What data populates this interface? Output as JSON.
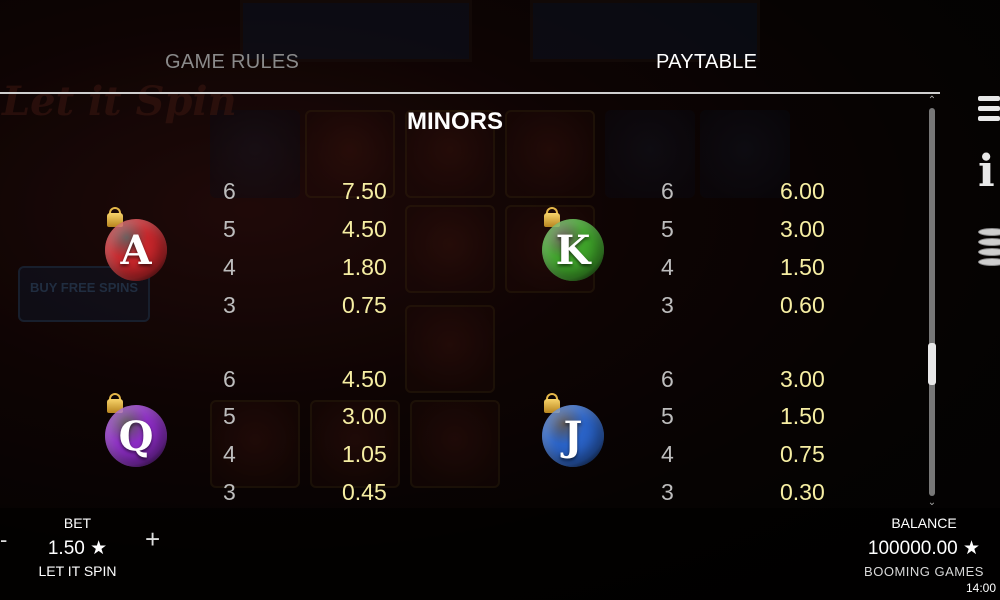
{
  "tabs": {
    "game_rules": "GAME RULES",
    "paytable": "PAYTABLE"
  },
  "section_title": "MINORS",
  "symbols": [
    {
      "letter": "A",
      "color": "#c8262b",
      "pays": [
        {
          "count": "6",
          "value": "7.50"
        },
        {
          "count": "5",
          "value": "4.50"
        },
        {
          "count": "4",
          "value": "1.80"
        },
        {
          "count": "3",
          "value": "0.75"
        }
      ]
    },
    {
      "letter": "K",
      "color": "#3fa42a",
      "pays": [
        {
          "count": "6",
          "value": "6.00"
        },
        {
          "count": "5",
          "value": "3.00"
        },
        {
          "count": "4",
          "value": "1.50"
        },
        {
          "count": "3",
          "value": "0.60"
        }
      ]
    },
    {
      "letter": "Q",
      "color": "#8c2cc4",
      "pays": [
        {
          "count": "6",
          "value": "4.50"
        },
        {
          "count": "5",
          "value": "3.00"
        },
        {
          "count": "4",
          "value": "1.05"
        },
        {
          "count": "3",
          "value": "0.45"
        }
      ]
    },
    {
      "letter": "J",
      "color": "#2a63c8",
      "pays": [
        {
          "count": "6",
          "value": "3.00"
        },
        {
          "count": "5",
          "value": "1.50"
        },
        {
          "count": "4",
          "value": "0.75"
        },
        {
          "count": "3",
          "value": "0.30"
        }
      ]
    }
  ],
  "background": {
    "logo": "Let it Spin",
    "buy_button": "BUY FREE SPINS"
  },
  "icons": {
    "menu": "menu-icon",
    "info": "info-icon",
    "coins": "coins-icon"
  },
  "bet": {
    "label": "BET",
    "value": "1.50 ★",
    "name": "LET IT SPIN",
    "minus": "-",
    "plus": "+"
  },
  "balance": {
    "label": "BALANCE",
    "value": "100000.00 ★",
    "brand": "BOOMING GAMES"
  },
  "clock": "14:00",
  "scroll_position": 0.68
}
